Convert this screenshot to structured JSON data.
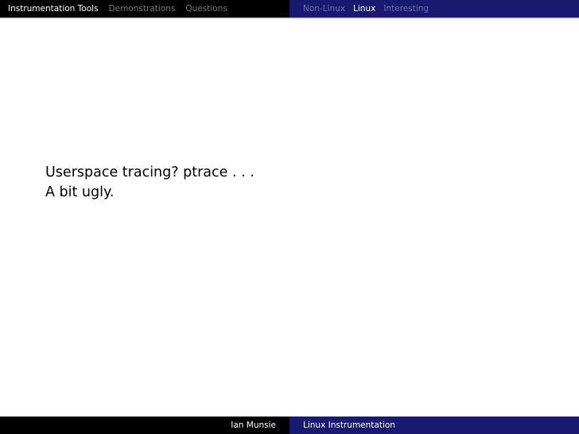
{
  "header": {
    "sections": [
      {
        "label": "Instrumentation Tools",
        "active": true
      },
      {
        "label": "Demonstrations",
        "active": false
      },
      {
        "label": "Questions",
        "active": false
      }
    ],
    "subsections": [
      {
        "label": "Non-Linux",
        "active": false
      },
      {
        "label": "Linux",
        "active": true
      },
      {
        "label": "Interesting",
        "active": false
      }
    ]
  },
  "slide": {
    "lines": [
      "Userspace tracing? ptrace . . .",
      "A bit ugly."
    ]
  },
  "footer": {
    "author": "Ian Munsie",
    "title": "Linux Instrumentation"
  },
  "colors": {
    "header_left_bg": "#000000",
    "header_right_bg": "#191970",
    "active_text": "#ffffff",
    "inactive_text": "#7a7a7a"
  }
}
